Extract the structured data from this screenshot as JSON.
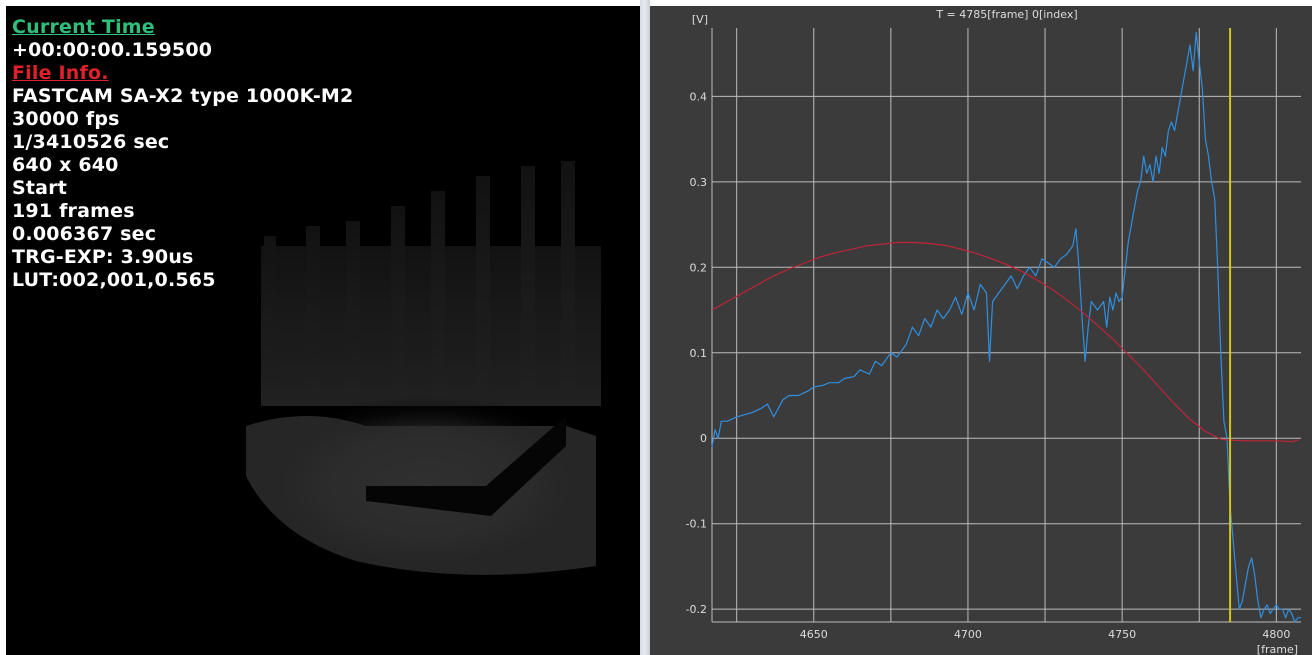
{
  "overlay": {
    "current_time_label": "Current Time",
    "current_time": "+00:00:00.159500",
    "file_info_label": "File Info.",
    "camera": "FASTCAM SA-X2 type 1000K-M2",
    "fps": "30000 fps",
    "shutter": "1/3410526 sec",
    "resolution": "640 x 640",
    "trigger_mode": "Start",
    "frames": "191 frames",
    "duration": "0.006367 sec",
    "trg_exp": "TRG-EXP: 3.90us",
    "lut": "LUT:002,001,0.565",
    "label_colors": {
      "current_time": "#2fbf7a",
      "file_info": "#e0202a"
    }
  },
  "graph": {
    "header": "T = 4785[frame] 0[index]",
    "ylabel_unit": "[V]",
    "xlabel_unit": "[frame]",
    "cursor_frame": 4785,
    "colors": {
      "background": "#3b3b3b",
      "blue_series": "#2f8fe0",
      "red_series": "#c02438",
      "cursor": "#d4c41a",
      "grid": "#bdbdbd"
    }
  },
  "chart_data": {
    "type": "line",
    "title": "",
    "xlabel": "[frame]",
    "ylabel": "[V]",
    "xlim": [
      4617,
      4808
    ],
    "ylim": [
      -0.215,
      0.48
    ],
    "xticks": [
      4650,
      4700,
      4750,
      4800
    ],
    "yticks": [
      -0.2,
      -0.1,
      0,
      0.1,
      0.2,
      0.3,
      0.4
    ],
    "xtick_labels": [
      "4650",
      "4700",
      "4750",
      "4800"
    ],
    "ytick_labels": [
      "-0.2",
      "-0.1",
      "0",
      "0.1",
      "0.2",
      "0.3",
      "0.4"
    ],
    "x_gridlines": [
      4617,
      4625,
      4650,
      4675,
      4700,
      4725,
      4750,
      4775,
      4800
    ],
    "grid": true,
    "cursor_x": 4785,
    "series": [
      {
        "color": "#2f8fe0",
        "x": [
          4617,
          4618,
          4619,
          4620,
          4622,
          4625,
          4628,
          4630,
          4633,
          4635,
          4637,
          4640,
          4642,
          4645,
          4648,
          4650,
          4653,
          4655,
          4658,
          4660,
          4663,
          4665,
          4668,
          4670,
          4672,
          4675,
          4677,
          4680,
          4682,
          4684,
          4686,
          4688,
          4690,
          4692,
          4694,
          4696,
          4698,
          4700,
          4702,
          4704,
          4706,
          4707,
          4708,
          4710,
          4712,
          4714,
          4716,
          4718,
          4720,
          4722,
          4724,
          4726,
          4728,
          4730,
          4732,
          4734,
          4735,
          4736,
          4737,
          4738,
          4739,
          4740,
          4742,
          4744,
          4745,
          4746,
          4747,
          4748,
          4749,
          4750,
          4752,
          4754,
          4755,
          4756,
          4757,
          4758,
          4759,
          4760,
          4761,
          4762,
          4763,
          4764,
          4765,
          4766,
          4767,
          4768,
          4769,
          4770,
          4771,
          4772,
          4773,
          4774,
          4775,
          4776,
          4777,
          4778,
          4779,
          4780,
          4781,
          4782,
          4783,
          4784,
          4785,
          4786,
          4787,
          4788,
          4789,
          4790,
          4791,
          4792,
          4793,
          4794,
          4795,
          4796,
          4797,
          4798,
          4799,
          4800,
          4801,
          4802,
          4803,
          4804,
          4805,
          4806,
          4807,
          4808
        ],
        "y": [
          -0.01,
          0.01,
          0.0,
          0.02,
          0.02,
          0.025,
          0.028,
          0.03,
          0.035,
          0.04,
          0.025,
          0.045,
          0.05,
          0.05,
          0.055,
          0.06,
          0.062,
          0.065,
          0.065,
          0.07,
          0.072,
          0.08,
          0.075,
          0.09,
          0.085,
          0.1,
          0.095,
          0.11,
          0.13,
          0.12,
          0.14,
          0.13,
          0.15,
          0.14,
          0.15,
          0.165,
          0.145,
          0.17,
          0.15,
          0.18,
          0.17,
          0.09,
          0.16,
          0.17,
          0.18,
          0.19,
          0.175,
          0.19,
          0.2,
          0.19,
          0.21,
          0.205,
          0.2,
          0.21,
          0.215,
          0.225,
          0.245,
          0.2,
          0.14,
          0.09,
          0.13,
          0.16,
          0.15,
          0.16,
          0.13,
          0.165,
          0.15,
          0.17,
          0.16,
          0.165,
          0.23,
          0.27,
          0.29,
          0.3,
          0.33,
          0.31,
          0.32,
          0.3,
          0.33,
          0.31,
          0.34,
          0.33,
          0.36,
          0.37,
          0.36,
          0.38,
          0.4,
          0.42,
          0.44,
          0.46,
          0.43,
          0.475,
          0.44,
          0.41,
          0.35,
          0.33,
          0.3,
          0.28,
          0.2,
          0.1,
          0.02,
          0.0,
          -0.08,
          -0.12,
          -0.16,
          -0.2,
          -0.19,
          -0.17,
          -0.15,
          -0.14,
          -0.16,
          -0.19,
          -0.21,
          -0.2,
          -0.195,
          -0.205,
          -0.2,
          -0.195,
          -0.2,
          -0.2,
          -0.21,
          -0.2,
          -0.205,
          -0.215,
          -0.21,
          -0.21
        ]
      },
      {
        "color": "#c02438",
        "x": [
          4617,
          4622,
          4627,
          4632,
          4637,
          4642,
          4647,
          4652,
          4657,
          4662,
          4667,
          4672,
          4677,
          4682,
          4687,
          4692,
          4697,
          4702,
          4707,
          4712,
          4717,
          4722,
          4727,
          4732,
          4737,
          4742,
          4747,
          4752,
          4757,
          4762,
          4767,
          4772,
          4777,
          4782,
          4784,
          4790,
          4795,
          4800,
          4805,
          4807
        ],
        "y": [
          0.15,
          0.16,
          0.17,
          0.18,
          0.19,
          0.198,
          0.205,
          0.212,
          0.217,
          0.221,
          0.225,
          0.227,
          0.229,
          0.229,
          0.228,
          0.226,
          0.222,
          0.217,
          0.211,
          0.204,
          0.196,
          0.186,
          0.175,
          0.162,
          0.148,
          0.132,
          0.116,
          0.098,
          0.08,
          0.06,
          0.04,
          0.022,
          0.008,
          -0.001,
          -0.002,
          -0.003,
          -0.003,
          -0.003,
          -0.004,
          -0.002
        ]
      }
    ]
  }
}
